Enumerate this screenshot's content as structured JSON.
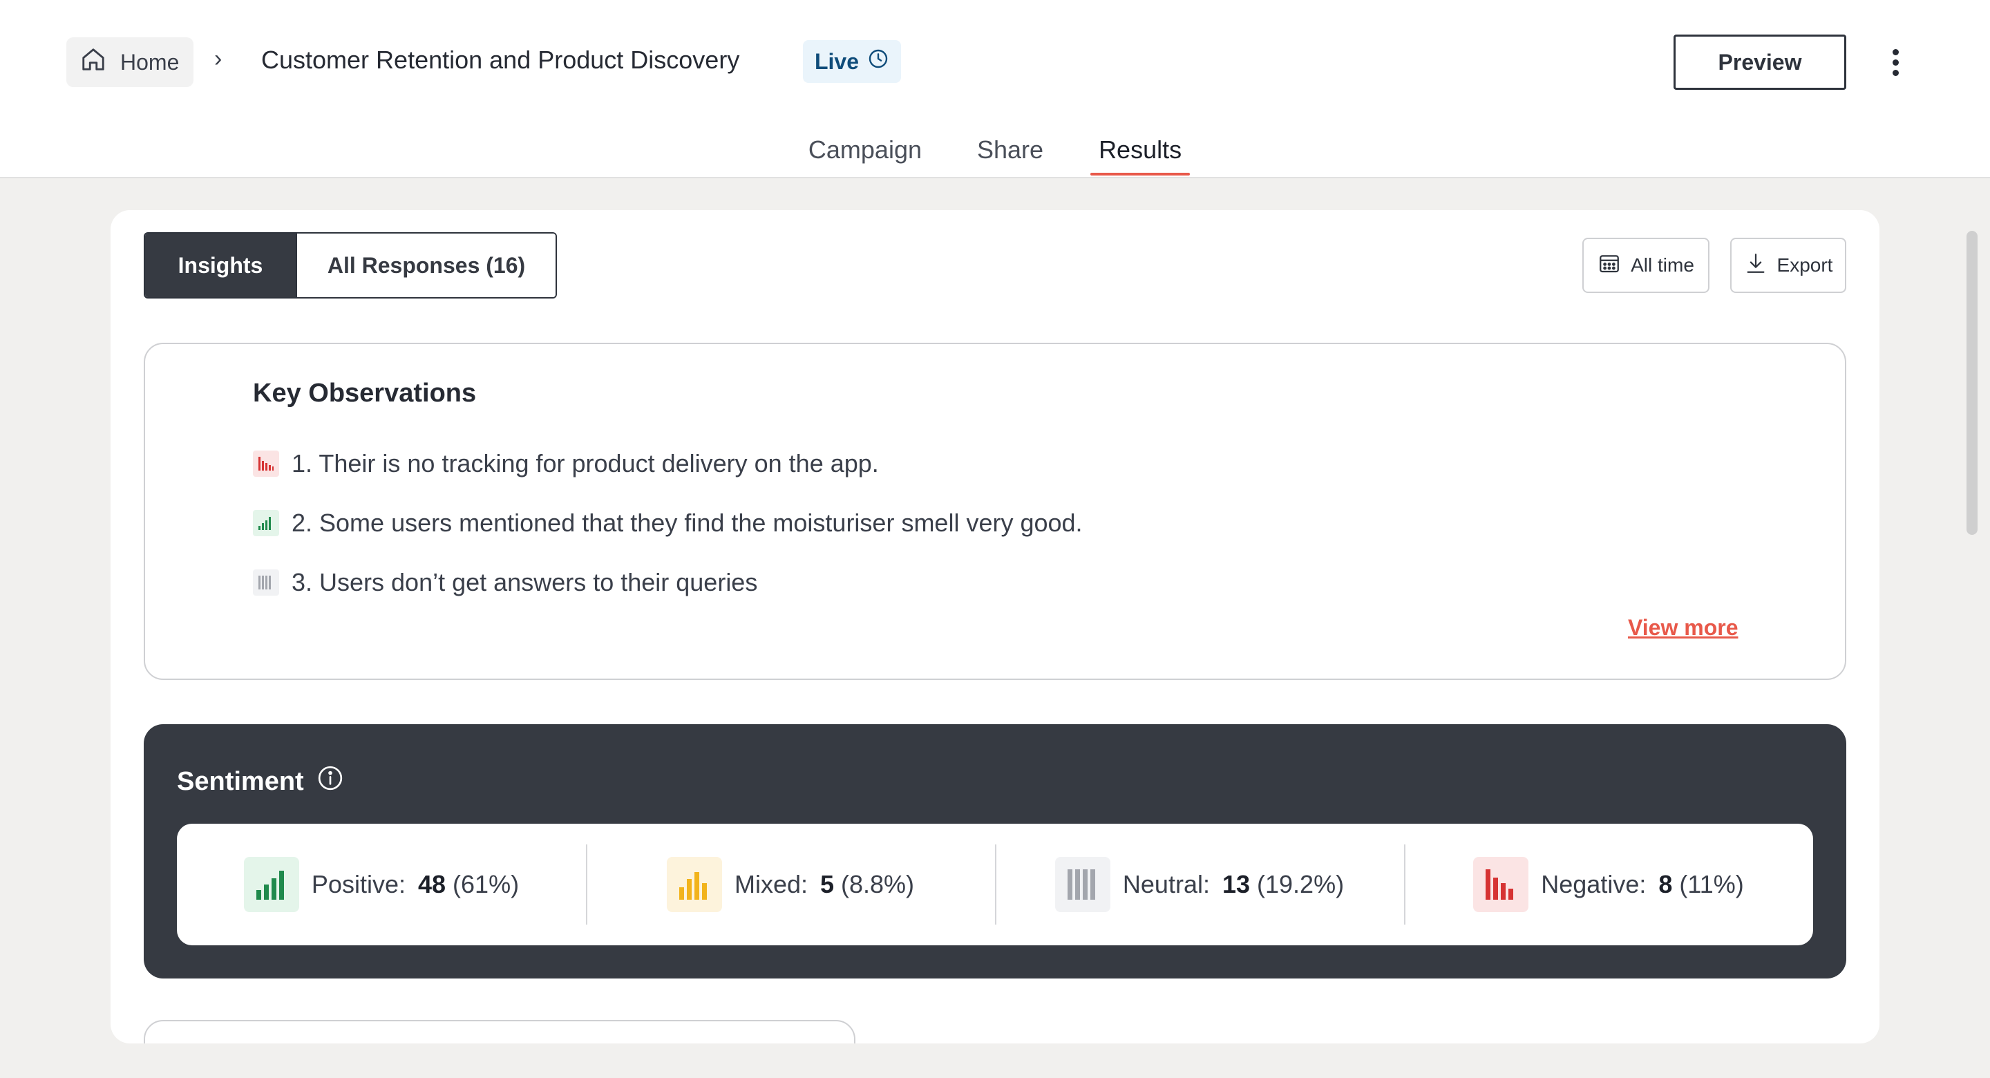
{
  "header": {
    "home_label": "Home",
    "breadcrumb_separator": "›",
    "title": "Customer Retention and Product Discovery",
    "status_label": "Live",
    "preview_label": "Preview"
  },
  "tabs": [
    {
      "label": "Campaign",
      "active": false
    },
    {
      "label": "Share",
      "active": false
    },
    {
      "label": "Results",
      "active": true
    }
  ],
  "results": {
    "segment": {
      "insights_label": "Insights",
      "responses_label": "All Responses (16)"
    },
    "date_filter_label": "All time",
    "export_label": "Export"
  },
  "observations": {
    "title": "Key Observations",
    "items": [
      {
        "text": "1. Their is no tracking for product delivery on the app.",
        "sentiment": "negative"
      },
      {
        "text": "2. Some users mentioned that they find the moisturiser smell very good.",
        "sentiment": "positive"
      },
      {
        "text": "3. Users don’t get answers to their queries",
        "sentiment": "neutral"
      }
    ],
    "view_more_label": "View more"
  },
  "sentiment": {
    "title": "Sentiment",
    "items": [
      {
        "label": "Positive:",
        "count": "48",
        "percent": "(61%)",
        "color": "#1f8a4c",
        "bg": "#e4f5ea"
      },
      {
        "label": "Mixed:",
        "count": "5",
        "percent": "(8.8%)",
        "color": "#f2b31b",
        "bg": "#fdf3dc"
      },
      {
        "label": "Neutral:",
        "count": "13",
        "percent": "(19.2%)",
        "color": "#a3a6ad",
        "bg": "#f1f2f4"
      },
      {
        "label": "Negative:",
        "count": "8",
        "percent": "(11%)",
        "color": "#d63333",
        "bg": "#fbe4e4"
      }
    ]
  },
  "colors": {
    "accent": "#e8594a",
    "dark": "#363a42",
    "live_badge_bg": "#eaf4fb"
  }
}
